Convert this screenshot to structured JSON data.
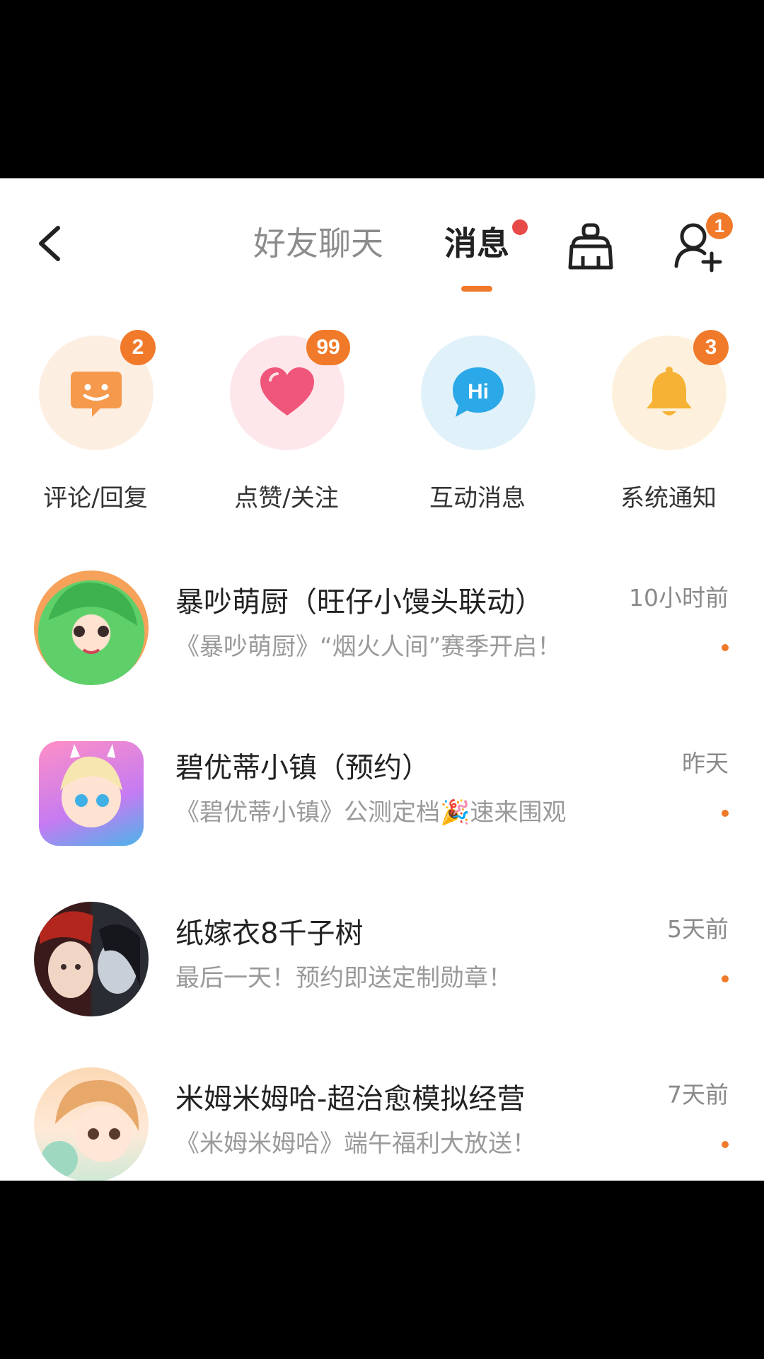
{
  "header": {
    "tab_friends": "好友聊天",
    "tab_messages": "消息",
    "add_friend_badge": "1"
  },
  "categories": [
    {
      "label": "评论/回复",
      "badge": "2",
      "bg": "#fdeee2",
      "icon": "comment-face-icon"
    },
    {
      "label": "点赞/关注",
      "badge": "99",
      "bg": "#fde7ea",
      "icon": "heart-icon"
    },
    {
      "label": "互动消息",
      "badge": "",
      "bg": "#e1f1fa",
      "icon": "hi-bubble-icon"
    },
    {
      "label": "系统通知",
      "badge": "3",
      "bg": "#fdf1dd",
      "icon": "bell-icon"
    }
  ],
  "messages": [
    {
      "title": "暴吵萌厨（旺仔小馒头联动）",
      "subtitle": "《暴吵萌厨》“烟火人间”赛季开启！",
      "time": "10小时前"
    },
    {
      "title": "碧优蒂小镇（预约）",
      "subtitle": "《碧优蒂小镇》公测定档🎉速来围观",
      "time": "昨天"
    },
    {
      "title": "纸嫁衣8千子树",
      "subtitle": "最后一天！预约即送定制勋章！",
      "time": "5天前"
    },
    {
      "title": "米姆米姆哈-超治愈模拟经营",
      "subtitle": "《米姆米姆哈》端午福利大放送！",
      "time": "7天前"
    }
  ]
}
